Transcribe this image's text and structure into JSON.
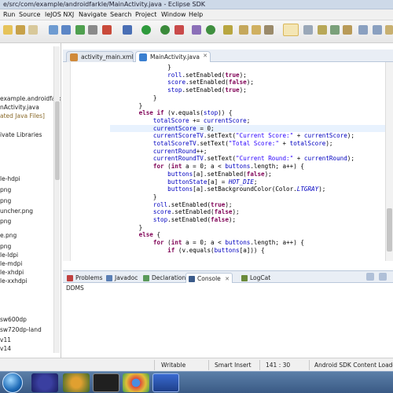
{
  "window": {
    "title": "e/src/com/example/androidfarkle/MainActivity.java - Eclipse SDK"
  },
  "menu": [
    "Run",
    "Source",
    "leJOS NXJ",
    "Navigate",
    "Search",
    "Project",
    "Window",
    "Help"
  ],
  "explorer": {
    "rows": [
      "",
      "",
      "example.androidfarkle",
      "nActivity.java",
      "ated Java Files]",
      "",
      "ivate Libraries",
      "",
      "",
      "",
      "",
      "le-hdpi",
      "png",
      "png",
      "uncher.png",
      "png",
      "e.png",
      "png",
      "le-ldpi",
      "le-mdpi",
      "le-xhdpi",
      "le-xxhdpi",
      "",
      "",
      "sw600dp",
      "sw720dp-land",
      "v11",
      "v14"
    ]
  },
  "editor": {
    "tabs": [
      {
        "label": "activity_main.xml"
      },
      {
        "label": "MainActivity.java"
      }
    ],
    "lines": [
      "                }",
      "                roll.setEnabled(true);",
      "                score.setEnabled(false);",
      "                stop.setEnabled(true);",
      "            }",
      "        }",
      "        else if (v.equals(stop)) {",
      "            totalScore += currentScore;",
      "            currentScore = 0;",
      "            currentScoreTV.setText(\"Current Score:\" + currentScore);",
      "            totalScoreTV.setText(\"Total Score:\" + totalScore);",
      "            currentRound++;",
      "            currentRoundTV.setText(\"Current Round:\" + currentRound);",
      "            for (int a = 0; a < buttons.length; a++) {",
      "                buttons[a].setEnabled(false);",
      "                buttonState[a] = HOT_DIE;",
      "                buttons[a].setBackgroundColor(Color.LTGRAY);",
      "            }",
      "            roll.setEnabled(true);",
      "            score.setEnabled(false);",
      "            stop.setEnabled(false);",
      "        }",
      "        else {",
      "            for (int a = 0; a < buttons.length; a++) {",
      "                if (v.equals(buttons[a])) {",
      "                    "
    ]
  },
  "views": {
    "tabs": [
      {
        "label": "Problems"
      },
      {
        "label": "Javadoc"
      },
      {
        "label": "Declaration"
      },
      {
        "label": "Console"
      },
      {
        "label": "LogCat"
      }
    ],
    "console_text": "DDMS"
  },
  "status": {
    "writable": "Writable",
    "insert_mode": "Smart Insert",
    "position": "141 : 30",
    "progress": "Android SDK Content Loader"
  },
  "colors": {
    "keyword": "#7f0055",
    "field": "#0000c0",
    "string": "#2a00ff",
    "highlight_line": "#e8f2fe"
  },
  "icons": {
    "taskbar": [
      "start-orb-icon",
      "eclipse-icon",
      "wmp-icon",
      "terminal-icon",
      "chrome-icon",
      "word-icon"
    ]
  }
}
